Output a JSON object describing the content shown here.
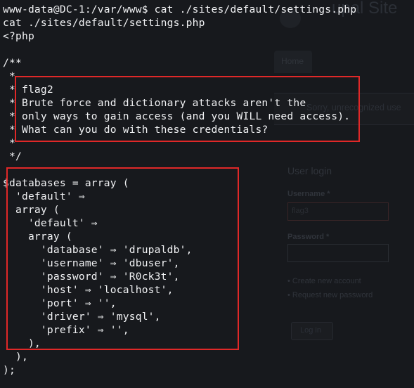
{
  "background_page": {
    "site_title": "upal Site",
    "tab_home": "Home",
    "notice": "Sorry, unrecognized use",
    "login_title": "User login",
    "username_label": "Username *",
    "username_value": "flag3",
    "password_label": "Password *",
    "create_account": "• Create new account",
    "request_password": "• Request new password",
    "login_button": "Log in"
  },
  "terminal": {
    "lines": [
      "www-data@DC-1:/var/www$ cat ./sites/default/settings.php",
      "cat ./sites/default/settings.php",
      "<?php",
      "",
      "/**",
      " *",
      " * flag2",
      " * Brute force and dictionary attacks aren't the",
      " * only ways to gain access (and you WILL need access).",
      " * What can you do with these credentials?",
      " *",
      " */",
      "",
      "$databases = array (",
      "  'default' ⇒",
      "  array (",
      "    'default' ⇒",
      "    array (",
      "      'database' ⇒ 'drupaldb',",
      "      'username' ⇒ 'dbuser',",
      "      'password' ⇒ 'R0ck3t',",
      "      'host' ⇒ 'localhost',",
      "      'port' ⇒ '',",
      "      'driver' ⇒ 'mysql',",
      "      'prefix' ⇒ '',",
      "    ),",
      "  ),",
      ");"
    ]
  },
  "colors": {
    "terminal_text": "#f1f2f4",
    "highlight_border": "#e02828",
    "background": "#17191d"
  }
}
